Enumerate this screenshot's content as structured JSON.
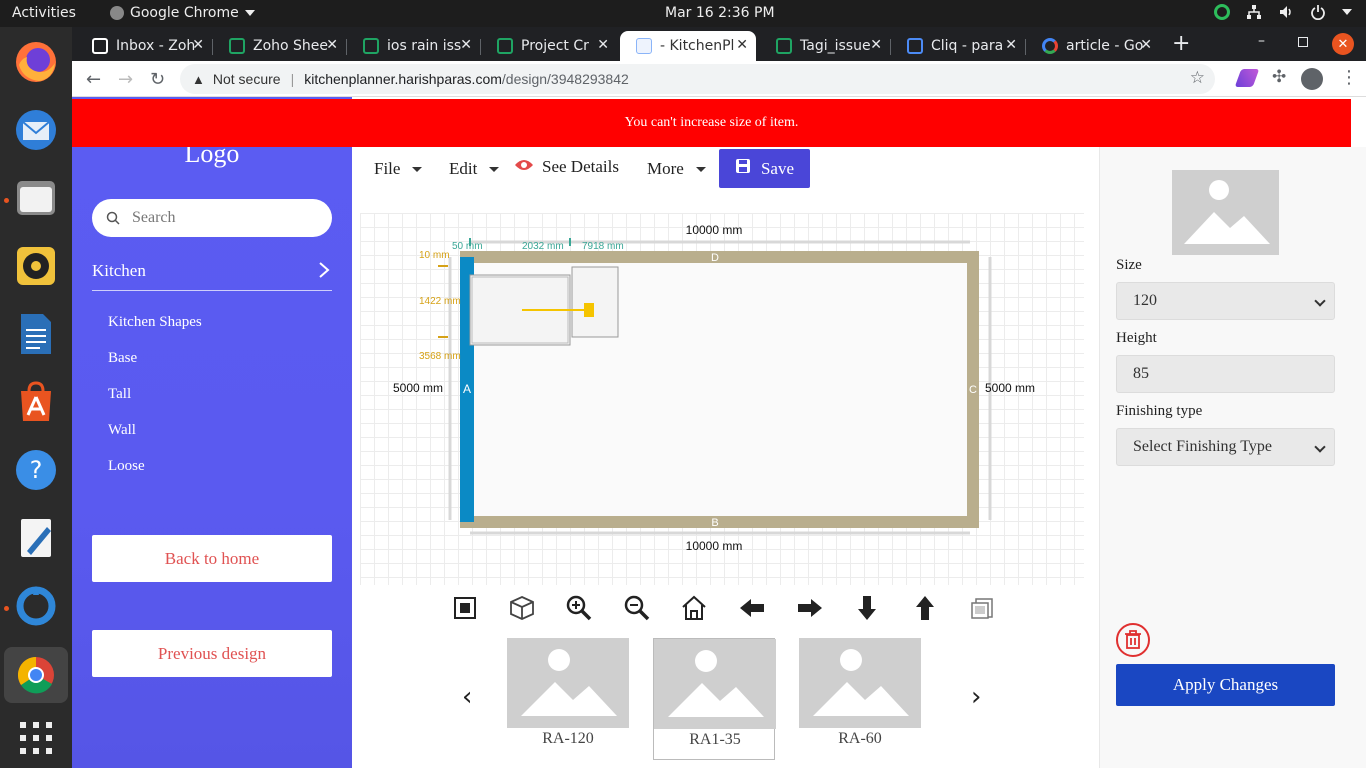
{
  "os": {
    "activities": "Activities",
    "app_name": "Google Chrome",
    "clock": "Mar 16  2:36 PM"
  },
  "dock": {
    "items": [
      "firefox",
      "thunderbird",
      "files",
      "rhythmbox",
      "libreoffice-writer",
      "app-center",
      "help",
      "text-editor",
      "zoho-app",
      "chrome",
      "show-apps"
    ]
  },
  "browser": {
    "tabs": [
      {
        "label": "Inbox - Zoh",
        "icon_color": "#ffffff"
      },
      {
        "label": "Zoho Shee",
        "icon_color": "#1fa463"
      },
      {
        "label": "ios rain iss",
        "icon_color": "#1fa463"
      },
      {
        "label": "Project Cr",
        "icon_color": "#1fa463"
      },
      {
        "label": "- KitchenPl",
        "icon_color": "#8ab4f8"
      },
      {
        "label": "Tagi_issue",
        "icon_color": "#1fa463"
      },
      {
        "label": "Cliq - para",
        "icon_color": "#4c8bf5"
      },
      {
        "label": "article - Go",
        "icon_color": "#ffffff"
      }
    ],
    "address": {
      "not_secure": "Not secure",
      "host": "kitchenplanner.harishparas.com",
      "path": "/design/3948293842"
    }
  },
  "alert": {
    "message": "You can't increase size of item."
  },
  "sidebar": {
    "logo": "Logo",
    "search_placeholder": "Search",
    "category": "Kitchen",
    "items": [
      "Kitchen Shapes",
      "Base",
      "Tall",
      "Wall",
      "Loose"
    ],
    "back_home": "Back to home",
    "previous_design": "Previous design"
  },
  "menubar": {
    "file": "File",
    "edit": "Edit",
    "see_details": "See Details",
    "more": "More",
    "save": "Save"
  },
  "plan": {
    "top_length": "10000 mm",
    "bottom_length": "10000 mm",
    "left_length": "5000 mm",
    "right_length": "5000 mm",
    "wall_labels": {
      "top": "D",
      "bottom": "B",
      "left": "A",
      "right": "C"
    },
    "dims": {
      "d50": "50 mm",
      "d2032": "2032 mm",
      "d7918": "7918 mm",
      "d10": "10 mm",
      "d1422": "1422 mm",
      "d3568": "3568 mm"
    },
    "colors": {
      "wall": "#b9ae8d",
      "selected_wall": "#0b8ac5",
      "handle": "#f5c400",
      "dim_green": "#3aa796",
      "dim_orange": "#d6a217"
    }
  },
  "controls": [
    "fit-screen-icon",
    "3d-view-icon",
    "zoom-in-icon",
    "zoom-out-icon",
    "home-icon",
    "arrow-left-icon",
    "arrow-right-icon",
    "arrow-down-icon",
    "arrow-up-icon",
    "screenshot-icon"
  ],
  "catalog": {
    "items": [
      {
        "label": "RA-120",
        "selected": false
      },
      {
        "label": "RA1-35",
        "selected": true
      },
      {
        "label": "RA-60",
        "selected": false
      }
    ],
    "prev": "‹",
    "next": "›"
  },
  "properties": {
    "size_label": "Size",
    "size_value": "120",
    "height_label": "Height",
    "height_value": "85",
    "finishing_label": "Finishing type",
    "finishing_value": "Select Finishing Type",
    "apply": "Apply Changes"
  }
}
